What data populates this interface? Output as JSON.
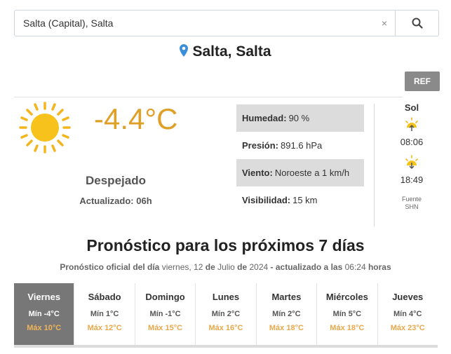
{
  "search": {
    "value": "Salta (Capital), Salta",
    "clear_label": "×"
  },
  "location": {
    "title": "Salta, Salta"
  },
  "ref_button": "REF",
  "current": {
    "temperature": "-4.4°C",
    "condition": "Despejado",
    "updated": "Actualizado: 06h"
  },
  "details": {
    "humidity_label": "Humedad:",
    "humidity_value": "90 %",
    "pressure_label": "Presión:",
    "pressure_value": "891.6 hPa",
    "wind_label": "Viento:",
    "wind_value": "Noroeste a 1 km/h",
    "visibility_label": "Visibilidad:",
    "visibility_value": "15 km"
  },
  "sun": {
    "title": "Sol",
    "sunrise": "08:06",
    "sunset": "18:49",
    "source_line1": "Fuente",
    "source_line2": "SHN"
  },
  "forecast": {
    "title": "Pronóstico para los próximos 7 días",
    "sub_1": "Pronóstico oficial del día",
    "sub_2": "viernes, 12",
    "sub_3": "de",
    "sub_4": "Julio",
    "sub_5": "de",
    "sub_6": "2024",
    "sub_7": "- actualizado a las",
    "sub_8": "06:24",
    "sub_9": "horas",
    "days": [
      {
        "name": "Viernes",
        "min": "Mín -4°C",
        "max": "Máx 10°C"
      },
      {
        "name": "Sábado",
        "min": "Mín 1°C",
        "max": "Máx 12°C"
      },
      {
        "name": "Domingo",
        "min": "Mín -1°C",
        "max": "Máx 15°C"
      },
      {
        "name": "Lunes",
        "min": "Mín 2°C",
        "max": "Máx 16°C"
      },
      {
        "name": "Martes",
        "min": "Mín 2°C",
        "max": "Máx 18°C"
      },
      {
        "name": "Miércoles",
        "min": "Mín 5°C",
        "max": "Máx 18°C"
      },
      {
        "name": "Jueves",
        "min": "Mín 4°C",
        "max": "Máx 23°C"
      }
    ]
  },
  "colors": {
    "temperature": "#e0a028",
    "max_temp": "#e9a84a",
    "pin": "#3b8fd9",
    "active_day": "#777777"
  },
  "icons": {
    "search": "search-icon",
    "pin": "map-pin-icon",
    "sun": "sun-icon",
    "sunrise": "sunrise-icon",
    "sunset": "sunset-icon"
  }
}
